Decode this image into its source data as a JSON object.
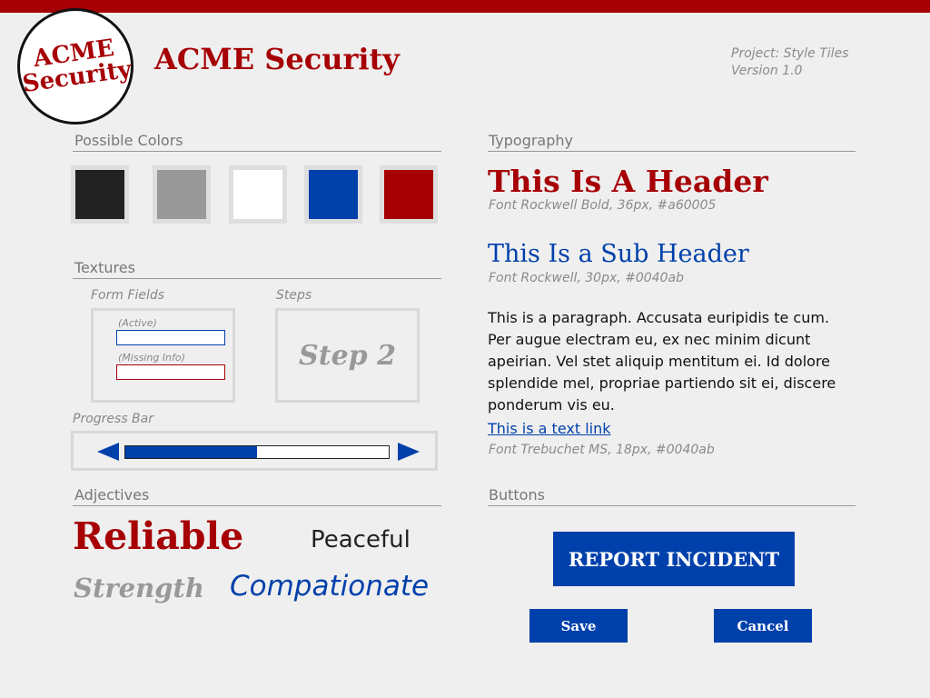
{
  "brand": {
    "logo_line1": "ACME",
    "logo_line2": "Security",
    "name": "ACME Security",
    "accent": "#a60005"
  },
  "meta": {
    "project": "Project: Style Tiles",
    "version": "Version 1.0"
  },
  "sections": {
    "colors": "Possible Colors",
    "textures": "Textures",
    "adjectives": "Adjectives",
    "typography": "Typography",
    "buttons": "Buttons"
  },
  "swatches": [
    "#222222",
    "#999999",
    "#ffffff",
    "#0040ab",
    "#a60005"
  ],
  "textures": {
    "form_fields_label": "Form Fields",
    "active_label": "(Active)",
    "missing_label": "(Missing Info)",
    "steps_label": "Steps",
    "step_text": "Step 2",
    "progress_label": "Progress Bar",
    "progress_fraction": 0.5
  },
  "adjectives": {
    "reliable": "Reliable",
    "peaceful": "Peaceful",
    "strength": "Strength",
    "compationate": "Compationate"
  },
  "typography": {
    "header": "This Is A Header",
    "header_note": "Font Rockwell Bold, 36px, #a60005",
    "subheader": "This Is a Sub Header",
    "subheader_note": "Font Rockwell, 30px, #0040ab",
    "paragraph": "This is a paragraph. Accusata euripidis te cum. Per augue electram eu, ex nec minim dicunt apeirian. Vel stet aliquip mentitum ei. Id dolore splendide mel, propriae partiendo sit ei, discere ponderum vis eu.",
    "link": "This is a text link",
    "paragraph_note": "Font Trebuchet MS, 18px, #0040ab"
  },
  "buttons": {
    "report": "REPORT INCIDENT",
    "save": "Save",
    "cancel": "Cancel"
  }
}
